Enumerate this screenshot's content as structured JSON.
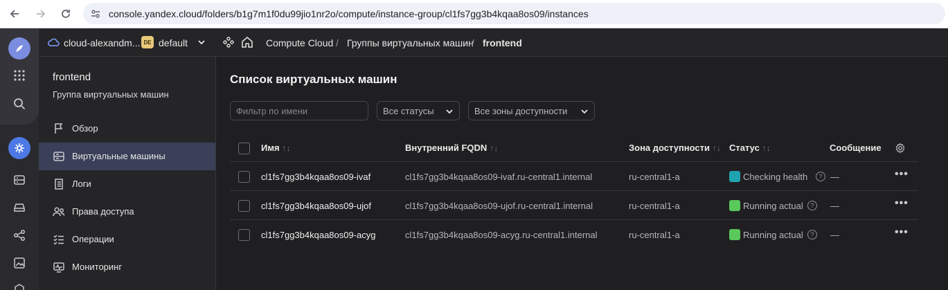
{
  "browser": {
    "url": "console.yandex.cloud/folders/b1g7m1f0du99jio1nr2o/compute/instance-group/cl1fs7gg3b4kqaa8os09/instances"
  },
  "header": {
    "cloud_name": "cloud-alexandm...",
    "folder_badge": "DE",
    "folder_name": "default",
    "breadcrumbs": [
      "Compute Cloud",
      "Группы виртуальных машин",
      "frontend"
    ],
    "separator": "/"
  },
  "sidebar": {
    "title": "frontend",
    "subtitle": "Группа виртуальных машин",
    "items": [
      {
        "label": "Обзор",
        "icon": "flag-icon"
      },
      {
        "label": "Виртуальные машины",
        "icon": "server-icon"
      },
      {
        "label": "Логи",
        "icon": "log-icon"
      },
      {
        "label": "Права доступа",
        "icon": "users-icon"
      },
      {
        "label": "Операции",
        "icon": "list-check-icon"
      },
      {
        "label": "Мониторинг",
        "icon": "monitor-icon"
      }
    ],
    "active_index": 1
  },
  "main": {
    "title": "Список виртуальных машин",
    "filter_placeholder": "Фильтр по имени",
    "status_filter": "Все статусы",
    "zone_filter": "Все зоны доступности",
    "columns": {
      "name": "Имя",
      "fqdn": "Внутренний FQDN",
      "zone": "Зона доступности",
      "status": "Статус",
      "message": "Сообщение"
    },
    "rows": [
      {
        "name": "cl1fs7gg3b4kqaa8os09-ivaf",
        "fqdn": "cl1fs7gg3b4kqaa8os09-ivaf.ru-central1.internal",
        "zone": "ru-central1-a",
        "status": "Checking health",
        "status_color": "#1fa3b0",
        "message": "—"
      },
      {
        "name": "cl1fs7gg3b4kqaa8os09-ujof",
        "fqdn": "cl1fs7gg3b4kqaa8os09-ujof.ru-central1.internal",
        "zone": "ru-central1-a",
        "status": "Running actual",
        "status_color": "#5ac85a",
        "message": "—"
      },
      {
        "name": "cl1fs7gg3b4kqaa8os09-acyg",
        "fqdn": "cl1fs7gg3b4kqaa8os09-acyg.ru-central1.internal",
        "zone": "ru-central1-a",
        "status": "Running actual",
        "status_color": "#5ac85a",
        "message": "—"
      }
    ],
    "help_glyph": "?",
    "more_glyph": "•••"
  },
  "colors": {
    "accent": "#4d78e6",
    "active_item_bg": "#3a4058"
  }
}
